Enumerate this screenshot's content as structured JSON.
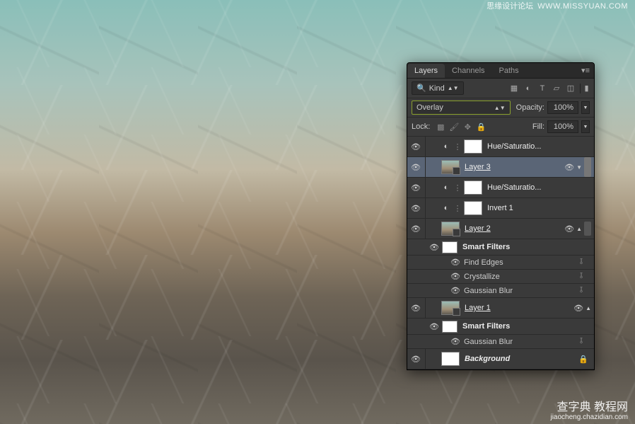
{
  "watermarks": {
    "top_right_cn": "思缘设计论坛",
    "top_right_url": "WWW.MISSYUAN.COM",
    "bottom_right_cn": "查字典 教程网",
    "bottom_right_url": "jiaocheng.chazidian.com"
  },
  "panel": {
    "tabs": [
      "Layers",
      "Channels",
      "Paths"
    ],
    "active_tab": 0,
    "filter_label": "Kind",
    "blend_mode": "Overlay",
    "opacity_label": "Opacity:",
    "opacity_value": "100%",
    "lock_label": "Lock:",
    "fill_label": "Fill:",
    "fill_value": "100%",
    "highlight_color": "#8aa02d"
  },
  "layers": [
    {
      "type": "adj",
      "name": "Hue/Saturatio...",
      "visible": true,
      "adj_icon": "half-circle"
    },
    {
      "type": "smart",
      "name": "Layer 3",
      "visible": true,
      "selected": true,
      "underline": true,
      "fx": true
    },
    {
      "type": "adj",
      "name": "Hue/Saturatio...",
      "visible": true,
      "adj_icon": "half-circle"
    },
    {
      "type": "adj",
      "name": "Invert 1",
      "visible": true,
      "adj_icon": "half-circle"
    },
    {
      "type": "smart",
      "name": "Layer 2",
      "visible": true,
      "underline": true,
      "fx": true,
      "smart_filters_label": "Smart Filters",
      "filters": [
        "Find Edges",
        "Crystallize",
        "Gaussian Blur"
      ]
    },
    {
      "type": "smart",
      "name": "Layer 1",
      "visible": true,
      "underline": true,
      "fx": true,
      "smart_filters_label": "Smart Filters",
      "filters": [
        "Gaussian Blur"
      ]
    },
    {
      "type": "bg",
      "name": "Background",
      "visible": true,
      "locked": true
    }
  ]
}
